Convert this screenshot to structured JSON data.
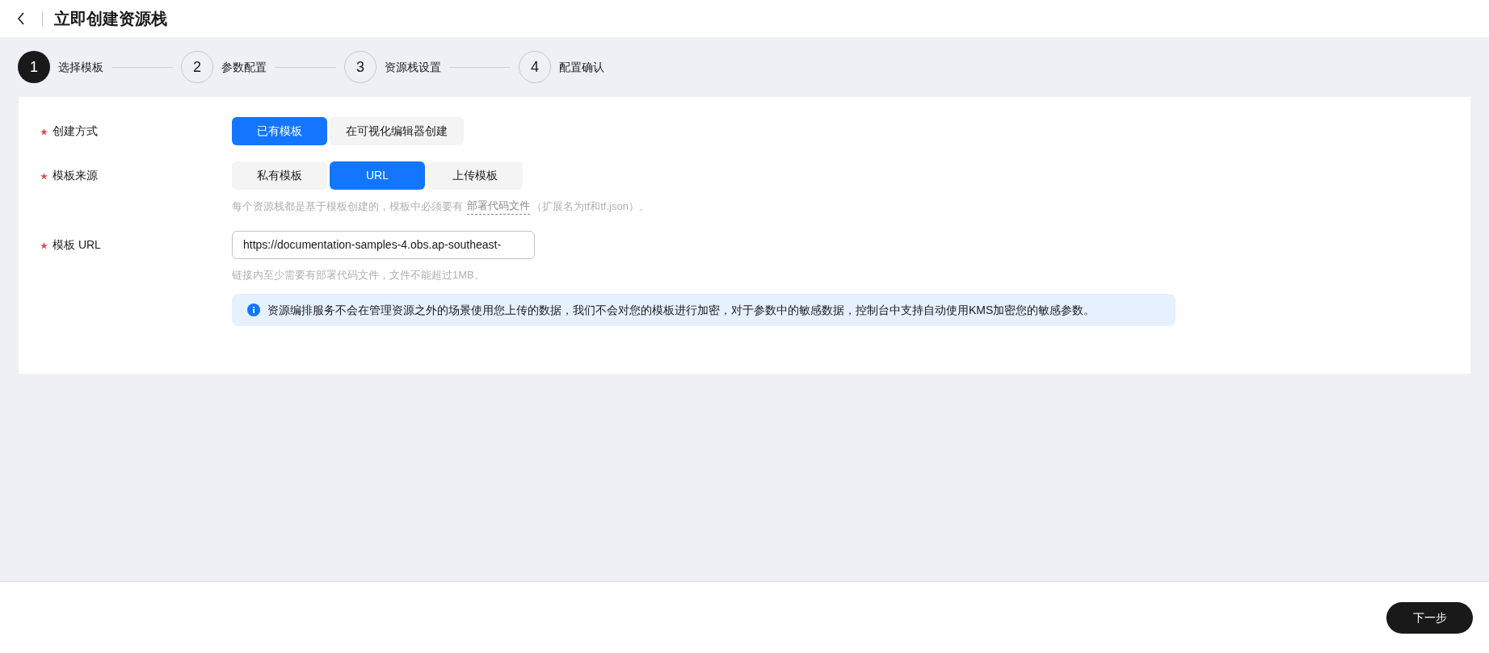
{
  "header": {
    "title": "立即创建资源栈"
  },
  "steps": [
    {
      "number": "1",
      "label": "选择模板",
      "selected": true
    },
    {
      "number": "2",
      "label": "参数配置",
      "selected": false
    },
    {
      "number": "3",
      "label": "资源栈设置",
      "selected": false
    },
    {
      "number": "4",
      "label": "配置确认",
      "selected": false
    }
  ],
  "form": {
    "rows": [
      {
        "kind": "segmented",
        "label": "创建方式",
        "required": true,
        "options": [
          {
            "label": "已有模板",
            "selected": true
          },
          {
            "label": "在可视化编辑器创建",
            "selected": false
          }
        ]
      },
      {
        "kind": "segmented",
        "label": "模板来源",
        "required": true,
        "options": [
          {
            "label": "私有模板",
            "selected": false
          },
          {
            "label": "URL",
            "selected": true
          },
          {
            "label": "上传模板",
            "selected": false
          }
        ],
        "help": {
          "before": "每个资源栈都是基于模板创建的，模板中必须要有",
          "link": "部署代码文件",
          "after": "（扩展名为tf和tf.json）。"
        }
      },
      {
        "kind": "input",
        "label": "模板 URL",
        "required": true,
        "value": "https://documentation-samples-4.obs.ap-southeast-",
        "help": {
          "before": "链接内至少需要有部署代码文件，文件不能超过1MB。"
        },
        "info": "资源编排服务不会在管理资源之外的场景使用您上传的数据，我们不会对您的模板进行加密，对于参数中的敏感数据，控制台中支持自动使用KMS加密您的敏感参数。"
      }
    ]
  },
  "footer": {
    "next_button": "下一步"
  }
}
